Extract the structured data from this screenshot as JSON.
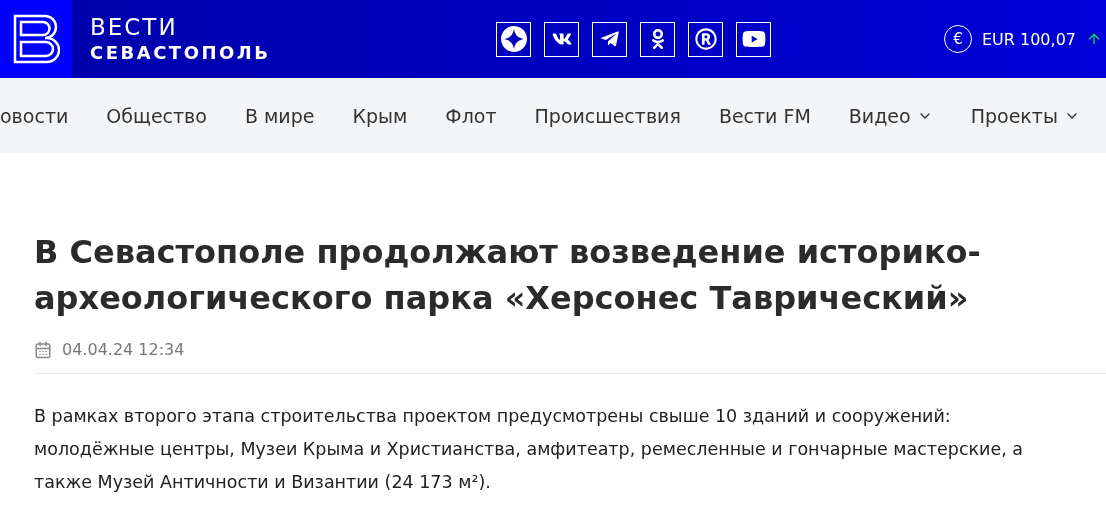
{
  "header": {
    "brand_top": "ВЕСТИ",
    "brand_bottom": "СЕВАСТОПОЛЬ",
    "social": [
      {
        "kind": "star"
      },
      {
        "kind": "vk"
      },
      {
        "kind": "telegram"
      },
      {
        "kind": "ok"
      },
      {
        "kind": "rutube"
      },
      {
        "kind": "youtube"
      }
    ],
    "currency": {
      "symbol": "€",
      "rate": "EUR 100,07",
      "rising": true
    }
  },
  "nav": [
    {
      "label": "овости",
      "dropdown": false
    },
    {
      "label": "Общество",
      "dropdown": false
    },
    {
      "label": "В мире",
      "dropdown": false
    },
    {
      "label": "Крым",
      "dropdown": false
    },
    {
      "label": "Флот",
      "dropdown": false
    },
    {
      "label": "Происшествия",
      "dropdown": false
    },
    {
      "label": "Вести FM",
      "dropdown": false
    },
    {
      "label": "Видео",
      "dropdown": true
    },
    {
      "label": "Проекты",
      "dropdown": true
    }
  ],
  "article": {
    "title": "В Севастополе продолжают возведение историко-археологического парка «Херсонес Таврический»",
    "date": "04.04.24 12:34",
    "lead": "В рамках второго этапа строительства проектом предусмотрены свыше 10 зданий и сооружений: молодёжные центры, Музеи Крыма и Христианства, амфитеатр, ремесленные и гончарные мастерские, а также Музей Античности и Византии (24 173 м²)."
  }
}
